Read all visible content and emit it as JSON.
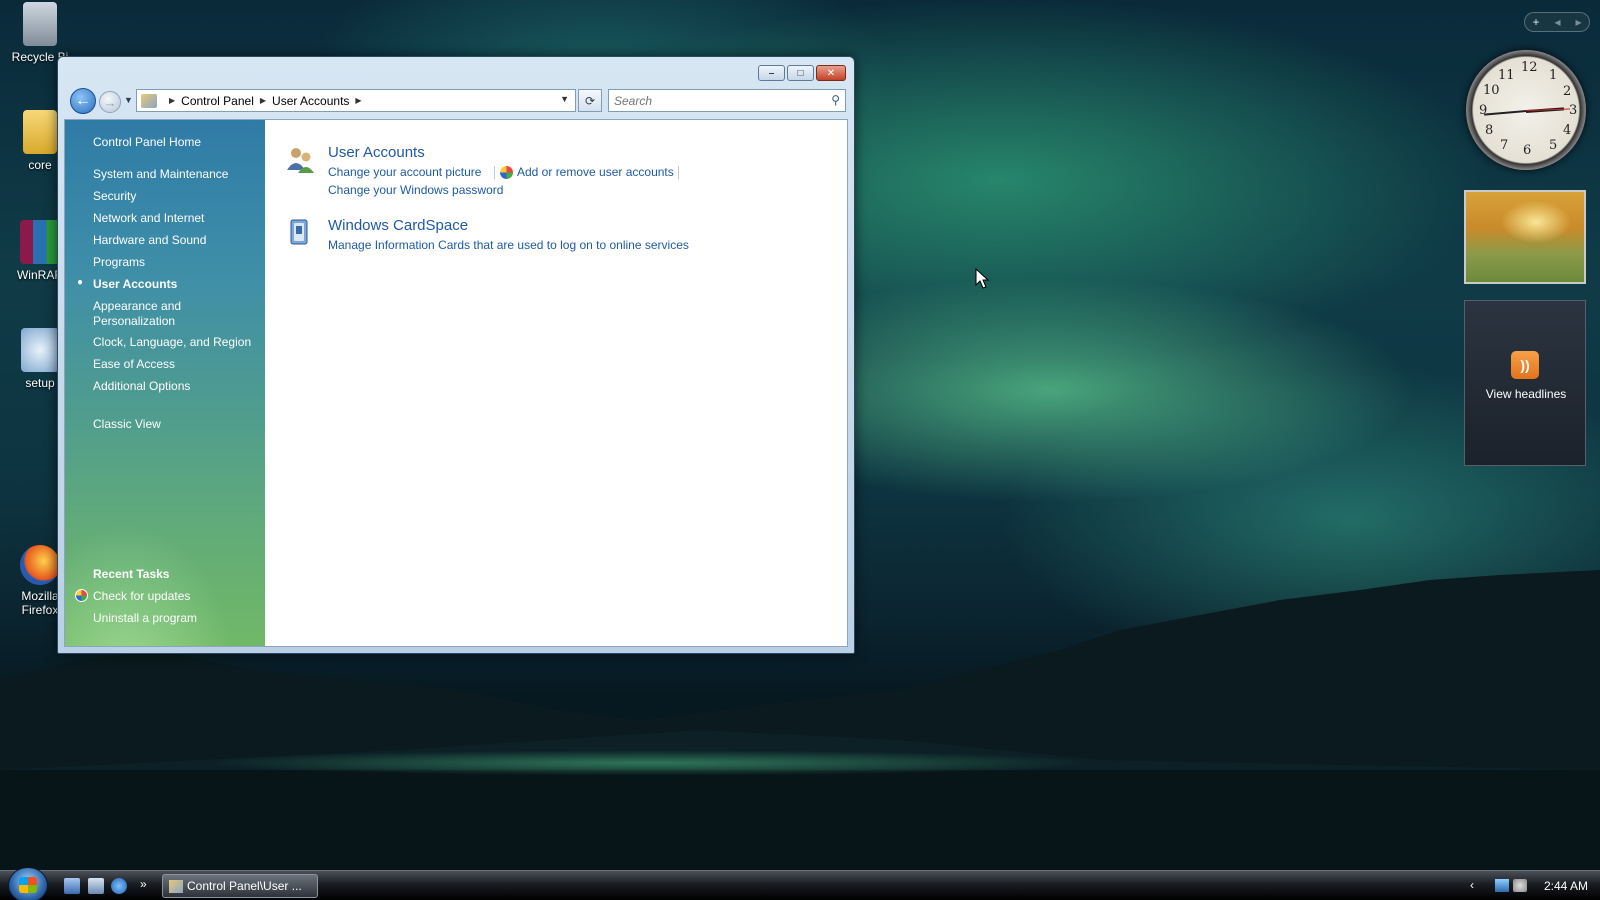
{
  "desktop": {
    "icons": [
      {
        "label": "Recycle Bi"
      },
      {
        "label": "core"
      },
      {
        "label": "WinRAR"
      },
      {
        "label": "setup"
      },
      {
        "label": "Mozilla Firefox"
      }
    ]
  },
  "window": {
    "address": {
      "crumbs": [
        "Control Panel",
        "User Accounts"
      ]
    },
    "search": {
      "placeholder": "Search"
    },
    "sidebar": {
      "items": [
        {
          "label": "Control Panel Home"
        },
        {
          "label": "System and Maintenance"
        },
        {
          "label": "Security"
        },
        {
          "label": "Network and Internet"
        },
        {
          "label": "Hardware and Sound"
        },
        {
          "label": "Programs"
        },
        {
          "label": "User Accounts"
        },
        {
          "label": "Appearance and"
        },
        {
          "label": "Personalization"
        },
        {
          "label": "Clock, Language, and Region"
        },
        {
          "label": "Ease of Access"
        },
        {
          "label": "Additional Options"
        },
        {
          "label": "Classic View"
        }
      ],
      "recent_tasks": {
        "heading": "Recent Tasks",
        "items": [
          {
            "label": "Check for updates"
          },
          {
            "label": "Uninstall a program"
          }
        ]
      }
    },
    "categories": [
      {
        "title": "User Accounts",
        "links": [
          "Change your account picture",
          "Add or remove user accounts",
          "Change your Windows password"
        ]
      },
      {
        "title": "Windows CardSpace",
        "links": [
          "Manage Information Cards that are used to log on to online services"
        ]
      }
    ]
  },
  "gadgets": {
    "feed_label": "View headlines",
    "clock_numbers": [
      "12",
      "1",
      "2",
      "3",
      "4",
      "5",
      "6",
      "7",
      "8",
      "9",
      "10",
      "11"
    ]
  },
  "taskbar": {
    "task_label": "Control Panel\\User ...",
    "time": "2:44 AM"
  }
}
